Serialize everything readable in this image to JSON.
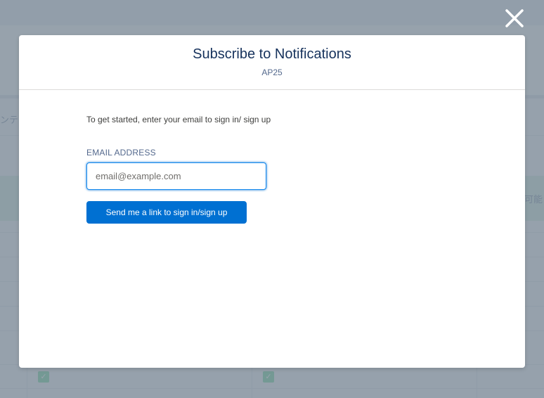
{
  "colors": {
    "brand": "#0070d2",
    "focus_border": "#1589ee",
    "title_text": "#16325c",
    "muted_text": "#54698d",
    "overlay": "#7e8c99"
  },
  "background": {
    "left_fragment": "ンテ",
    "right_fragment": "可能"
  },
  "close": {
    "icon": "close-icon"
  },
  "modal": {
    "title": "Subscribe to Notifications",
    "subtitle": "AP25",
    "intro": "To get started, enter your email to sign in/ sign up",
    "email_label": "EMAIL ADDRESS",
    "email_value": "",
    "email_placeholder": "email@example.com",
    "submit_label": "Send me a link to sign in/sign up"
  }
}
